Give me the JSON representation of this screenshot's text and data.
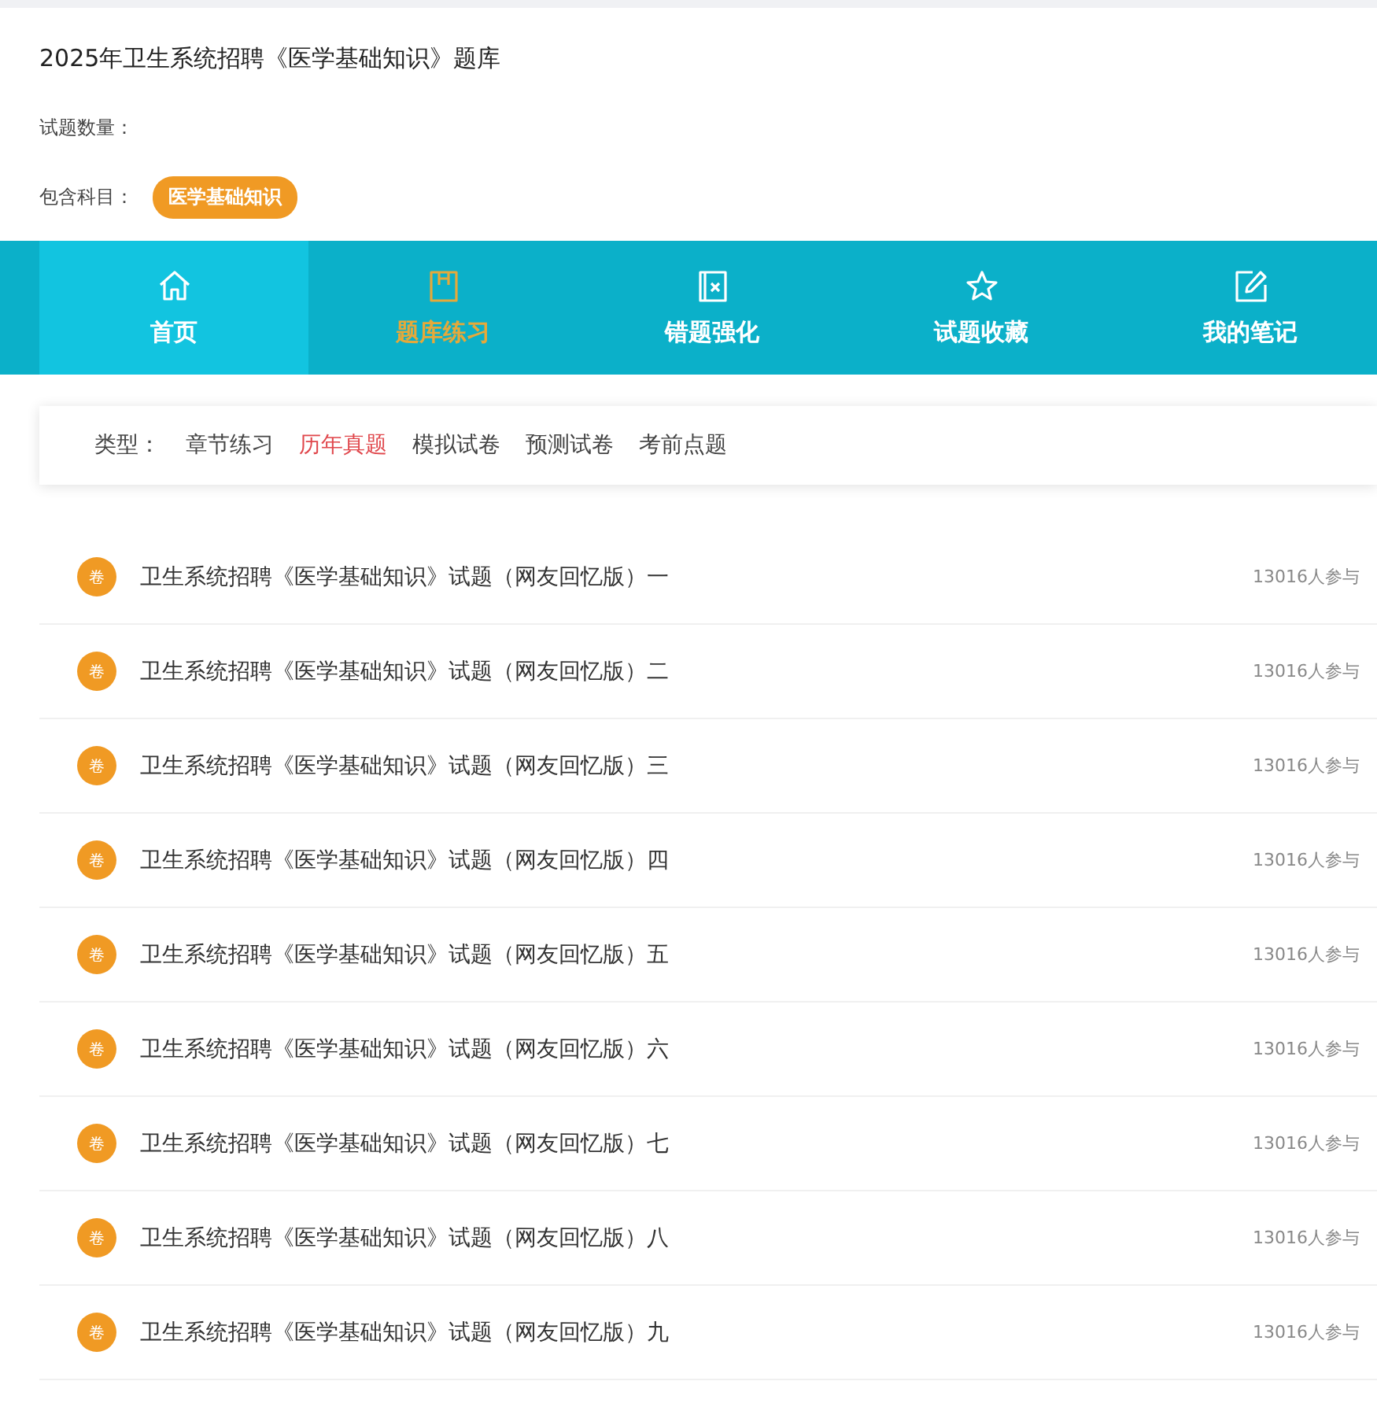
{
  "header": {
    "title": "2025年卫生系统招聘《医学基础知识》题库",
    "question_count_label": "试题数量：",
    "subjects_label": "包含科目：",
    "subjects": [
      "医学基础知识"
    ]
  },
  "nav_tabs": [
    {
      "label": "首页",
      "kind": "home",
      "selected": false,
      "hovered": true
    },
    {
      "label": "题库练习",
      "kind": "book",
      "selected": true,
      "hovered": false
    },
    {
      "label": "错题强化",
      "kind": "mistakes",
      "selected": false,
      "hovered": false
    },
    {
      "label": "试题收藏",
      "kind": "favorites",
      "selected": false,
      "hovered": false
    },
    {
      "label": "我的笔记",
      "kind": "notes",
      "selected": false,
      "hovered": false
    }
  ],
  "type_filter": {
    "label": "类型：",
    "options": [
      {
        "label": "章节练习",
        "selected": false
      },
      {
        "label": "历年真题",
        "selected": true
      },
      {
        "label": "模拟试卷",
        "selected": false
      },
      {
        "label": "预测试卷",
        "selected": false
      },
      {
        "label": "考前点题",
        "selected": false
      }
    ]
  },
  "papers": [
    {
      "badge": "卷",
      "title": "卫生系统招聘《医学基础知识》试题（网友回忆版）一",
      "participants": "13016人参与"
    },
    {
      "badge": "卷",
      "title": "卫生系统招聘《医学基础知识》试题（网友回忆版）二",
      "participants": "13016人参与"
    },
    {
      "badge": "卷",
      "title": "卫生系统招聘《医学基础知识》试题（网友回忆版）三",
      "participants": "13016人参与"
    },
    {
      "badge": "卷",
      "title": "卫生系统招聘《医学基础知识》试题（网友回忆版）四",
      "participants": "13016人参与"
    },
    {
      "badge": "卷",
      "title": "卫生系统招聘《医学基础知识》试题（网友回忆版）五",
      "participants": "13016人参与"
    },
    {
      "badge": "卷",
      "title": "卫生系统招聘《医学基础知识》试题（网友回忆版）六",
      "participants": "13016人参与"
    },
    {
      "badge": "卷",
      "title": "卫生系统招聘《医学基础知识》试题（网友回忆版）七",
      "participants": "13016人参与"
    },
    {
      "badge": "卷",
      "title": "卫生系统招聘《医学基础知识》试题（网友回忆版）八",
      "participants": "13016人参与"
    },
    {
      "badge": "卷",
      "title": "卫生系统招聘《医学基础知识》试题（网友回忆版）九",
      "participants": "13016人参与"
    }
  ]
}
